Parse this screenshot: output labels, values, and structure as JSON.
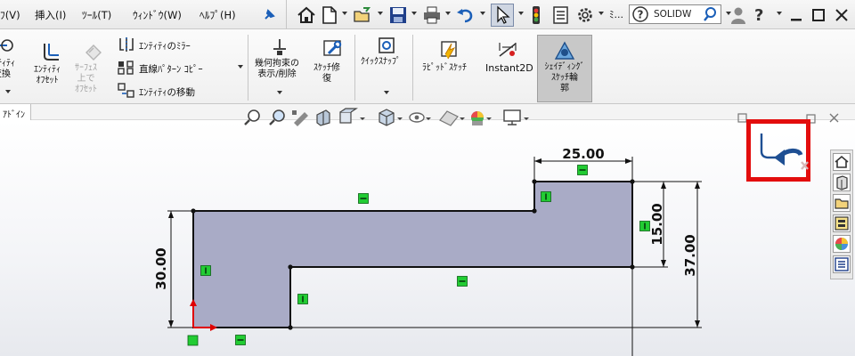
{
  "menu": {
    "items": [
      "ﾌ(V)",
      "挿入(I)",
      "ﾂｰﾙ(T)",
      "ｳｨﾝﾄﾞｳ(W)",
      "ﾍﾙﾌﾟ(H)"
    ],
    "truncated": "ﾐ..."
  },
  "search": {
    "placeholder": "SOLIDW"
  },
  "ribbon": {
    "convert_entities": "ﾝﾃｨﾃｨ\n変換",
    "offset_entities": "ｴﾝﾃｨﾃｨ\nｵﾌｾｯﾄ",
    "offset_on_surface": "ｻｰﾌｪｽ\n上で\nｵﾌｾｯﾄ",
    "mirror_entities": "ｴﾝﾃｨﾃｨのﾐﾗｰ",
    "linear_pattern": "直線ﾊﾟﾀｰﾝ ｺﾋﾟｰ",
    "move_entities": "ｴﾝﾃｨﾃｨの移動",
    "display_delete_relations": "幾何拘束の\n表示/削除",
    "repair_sketch": "ｽｹｯﾁ修\n復",
    "quick_snaps": "ｸｲｯｸｽﾅｯﾌﾟ",
    "rapid_sketch": "ﾗﾋﾟｯﾄﾞｽｹｯﾁ",
    "instant2d": "Instant2D",
    "shaded_sketch_contours": "ｼｪｲﾃﾞｨﾝｸﾞ\nｽｹｯﾁ輪\n郭"
  },
  "tabs": {
    "addin": "ｱﾄﾞｲﾝ"
  },
  "dimensions": {
    "top_width": "25.00",
    "left_height": "30.00",
    "right_step": "15.00",
    "total_height": "37.00"
  },
  "colors": {
    "sketch_fill": "#a9abc6",
    "relation_marker": "#22cc33",
    "highlight": "#e30d0d",
    "origin": "#e00000"
  },
  "icons": {
    "exit_sketch": "exit-sketch-icon",
    "home": "home-icon",
    "new_doc": "new-document-icon",
    "open": "open-folder-icon",
    "save": "save-icon",
    "print": "print-icon",
    "undo": "undo-icon",
    "select": "select-cursor-icon",
    "options": "gear-icon",
    "help": "help-icon",
    "user": "user-icon"
  }
}
